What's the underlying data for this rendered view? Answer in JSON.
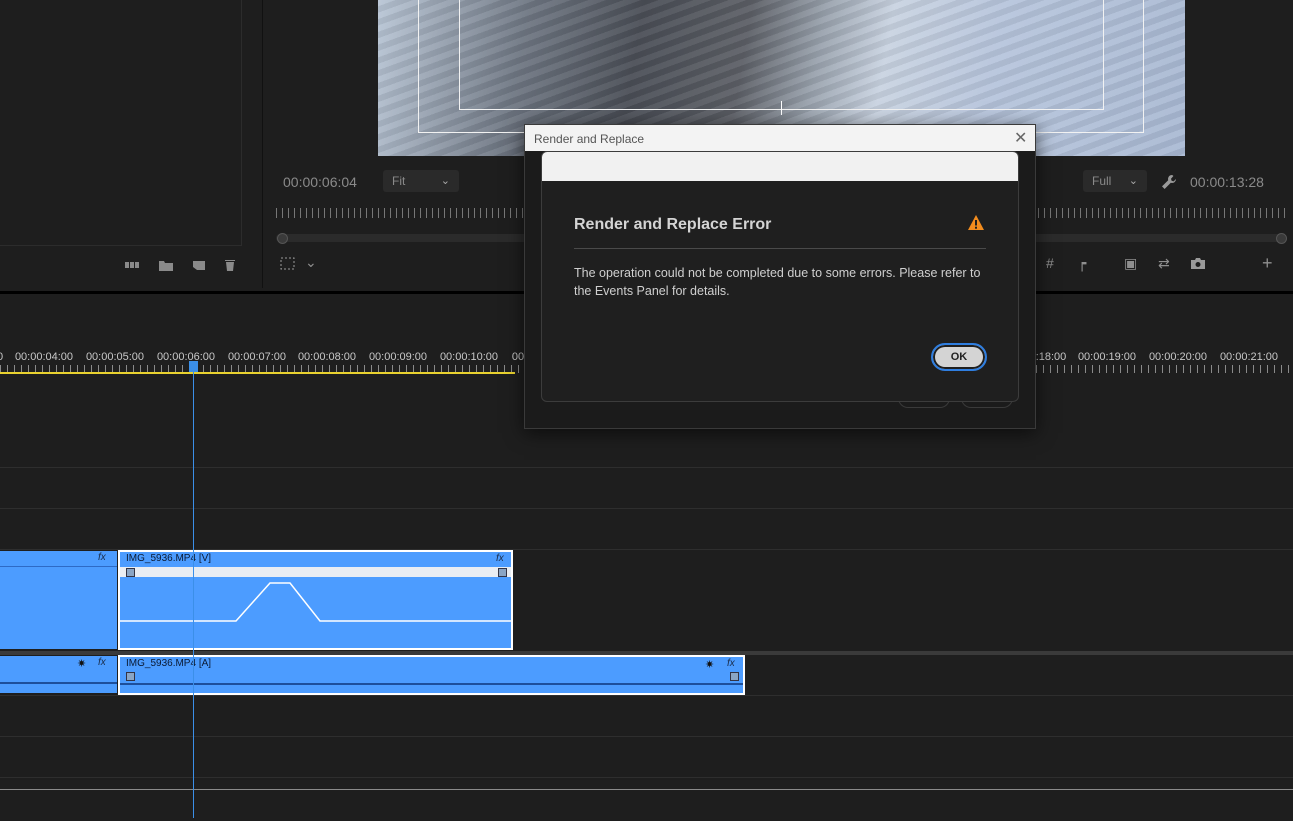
{
  "program_monitor": {
    "current_timecode": "00:00:06:04",
    "zoom_select": "Fit",
    "resolution_select": "Full",
    "duration_timecode": "00:00:13:28"
  },
  "timeline": {
    "ruler_labels_left": [
      "0",
      "00:00:04:00",
      "00:00:05:00",
      "00:00:06:00",
      "00:00:07:00",
      "00:00:08:00",
      "00:00:09:00",
      "00:00:10:00",
      "00"
    ],
    "ruler_labels_right": [
      ":18:00",
      "00:00:19:00",
      "00:00:20:00",
      "00:00:21:00"
    ],
    "video_clip_name": "IMG_5936.MP4 [V]",
    "audio_clip_name": "IMG_5936.MP4 [A]",
    "fx_label": "fx"
  },
  "dialog": {
    "window_title": "Render and Replace",
    "heading": "Render and Replace Error",
    "message": "The operation could not be completed due to some errors. Please refer to the Events Panel for details.",
    "ok_label": "OK"
  },
  "colors": {
    "clip_blue": "#4c9cff",
    "playhead_blue": "#3b8fe8",
    "work_area_yellow": "#e9d22f",
    "warning_orange": "#f28c1e"
  }
}
